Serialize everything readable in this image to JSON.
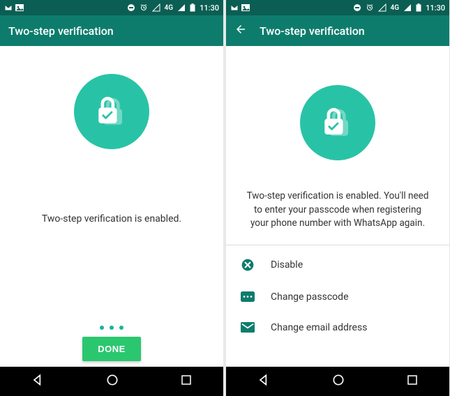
{
  "left": {
    "statusbar": {
      "network": "4G",
      "time": "11:30"
    },
    "appbar": {
      "title": "Two-step verification"
    },
    "message": "Two-step verification is enabled.",
    "done_label": "DONE"
  },
  "right": {
    "statusbar": {
      "network": "4G",
      "time": "11:30"
    },
    "appbar": {
      "title": "Two-step verification"
    },
    "message": "Two-step verification is enabled. You'll need to enter your passcode when registering your phone number with WhatsApp again.",
    "options": {
      "disable": "Disable",
      "change_passcode": "Change passcode",
      "change_email": "Change email address"
    }
  }
}
